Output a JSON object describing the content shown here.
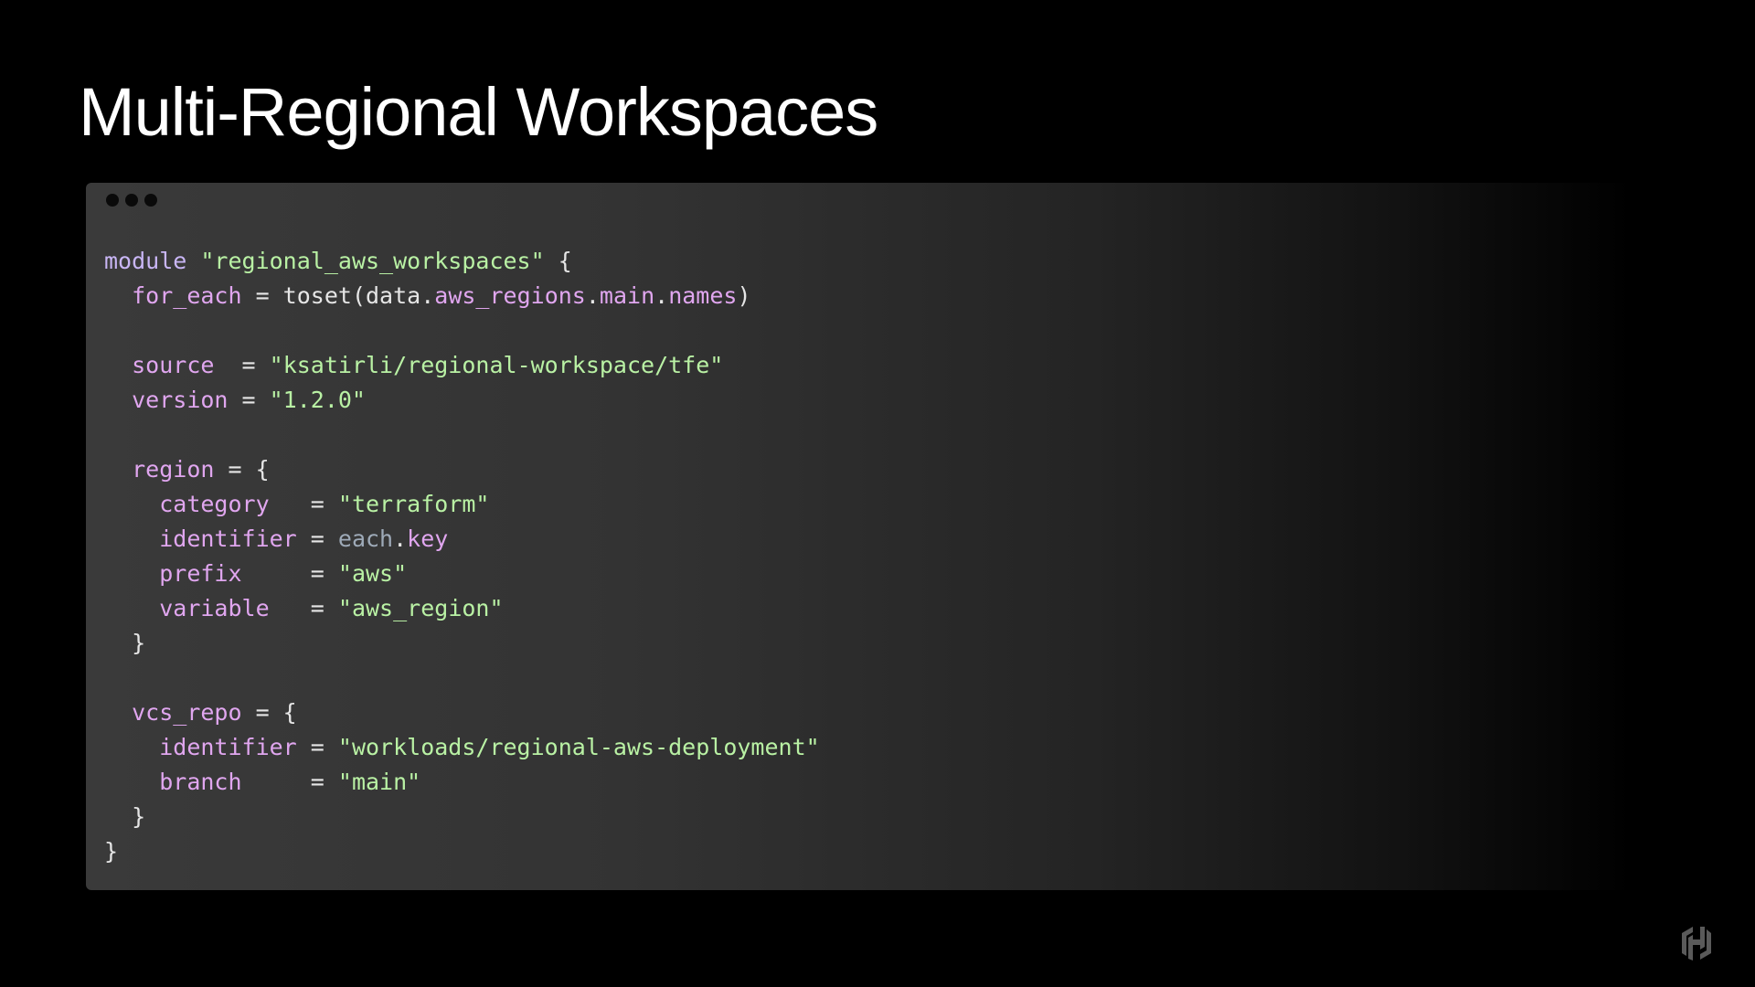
{
  "slide": {
    "title": "Multi-Regional Workspaces"
  },
  "colors": {
    "background": "#000000",
    "title": "#ffffff",
    "window_dots": "#0a0a0a",
    "keyword": "#c9b6f5",
    "attribute": "#e0a6ef",
    "string": "#b9f1a4",
    "plain": "#e6e6e6",
    "each": "#9eaab8",
    "logo": "#5a5a5a"
  },
  "code_window": {
    "dots": [
      "dot",
      "dot",
      "dot"
    ],
    "lines": [
      [
        {
          "t": "module",
          "c": "keyword"
        },
        {
          "t": " ",
          "c": "plain"
        },
        {
          "t": "\"regional_aws_workspaces\"",
          "c": "string"
        },
        {
          "t": " {",
          "c": "plain"
        }
      ],
      [
        {
          "t": "  ",
          "c": "plain"
        },
        {
          "t": "for_each",
          "c": "attribute"
        },
        {
          "t": " = toset(",
          "c": "plain"
        },
        {
          "t": "data",
          "c": "plain"
        },
        {
          "t": ".",
          "c": "plain"
        },
        {
          "t": "aws_regions",
          "c": "attribute"
        },
        {
          "t": ".",
          "c": "plain"
        },
        {
          "t": "main",
          "c": "attribute"
        },
        {
          "t": ".",
          "c": "plain"
        },
        {
          "t": "names",
          "c": "attribute"
        },
        {
          "t": ")",
          "c": "plain"
        }
      ],
      [],
      [
        {
          "t": "  ",
          "c": "plain"
        },
        {
          "t": "source",
          "c": "attribute"
        },
        {
          "t": "  = ",
          "c": "plain"
        },
        {
          "t": "\"ksatirli/regional-workspace/tfe\"",
          "c": "string"
        }
      ],
      [
        {
          "t": "  ",
          "c": "plain"
        },
        {
          "t": "version",
          "c": "attribute"
        },
        {
          "t": " = ",
          "c": "plain"
        },
        {
          "t": "\"1.2.0\"",
          "c": "string"
        }
      ],
      [],
      [
        {
          "t": "  ",
          "c": "plain"
        },
        {
          "t": "region",
          "c": "attribute"
        },
        {
          "t": " = {",
          "c": "plain"
        }
      ],
      [
        {
          "t": "    ",
          "c": "plain"
        },
        {
          "t": "category",
          "c": "attribute"
        },
        {
          "t": "   = ",
          "c": "plain"
        },
        {
          "t": "\"terraform\"",
          "c": "string"
        }
      ],
      [
        {
          "t": "    ",
          "c": "plain"
        },
        {
          "t": "identifier",
          "c": "attribute"
        },
        {
          "t": " = ",
          "c": "plain"
        },
        {
          "t": "each",
          "c": "each"
        },
        {
          "t": ".",
          "c": "plain"
        },
        {
          "t": "key",
          "c": "attribute"
        }
      ],
      [
        {
          "t": "    ",
          "c": "plain"
        },
        {
          "t": "prefix",
          "c": "attribute"
        },
        {
          "t": "     = ",
          "c": "plain"
        },
        {
          "t": "\"aws\"",
          "c": "string"
        }
      ],
      [
        {
          "t": "    ",
          "c": "plain"
        },
        {
          "t": "variable",
          "c": "attribute"
        },
        {
          "t": "   = ",
          "c": "plain"
        },
        {
          "t": "\"aws_region\"",
          "c": "string"
        }
      ],
      [
        {
          "t": "  }",
          "c": "plain"
        }
      ],
      [],
      [
        {
          "t": "  ",
          "c": "plain"
        },
        {
          "t": "vcs_repo",
          "c": "attribute"
        },
        {
          "t": " = {",
          "c": "plain"
        }
      ],
      [
        {
          "t": "    ",
          "c": "plain"
        },
        {
          "t": "identifier",
          "c": "attribute"
        },
        {
          "t": " = ",
          "c": "plain"
        },
        {
          "t": "\"workloads/regional-aws-deployment\"",
          "c": "string"
        }
      ],
      [
        {
          "t": "    ",
          "c": "plain"
        },
        {
          "t": "branch",
          "c": "attribute"
        },
        {
          "t": "     = ",
          "c": "plain"
        },
        {
          "t": "\"main\"",
          "c": "string"
        }
      ],
      [
        {
          "t": "  }",
          "c": "plain"
        }
      ],
      [
        {
          "t": "}",
          "c": "plain"
        }
      ]
    ]
  },
  "branding": {
    "logo_icon": "hashicorp-logo-icon"
  }
}
